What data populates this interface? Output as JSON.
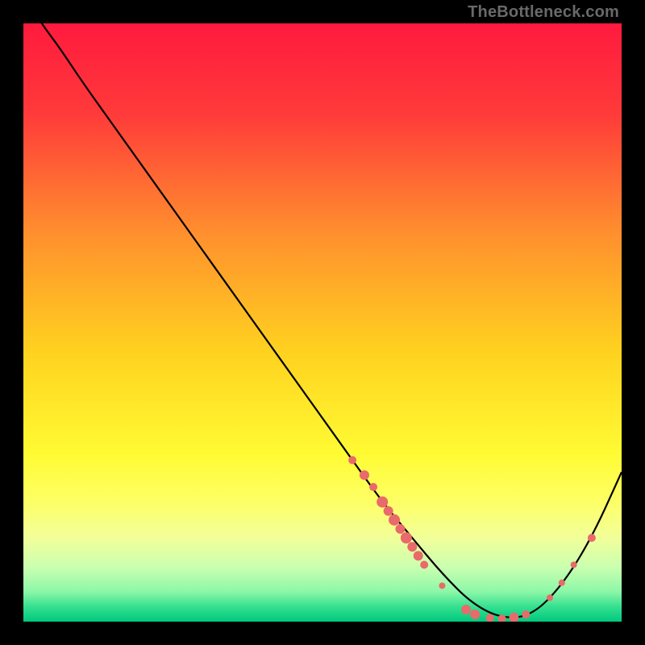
{
  "watermark": "TheBottleneck.com",
  "chart_data": {
    "type": "line",
    "title": "",
    "xlabel": "",
    "ylabel": "",
    "xlim": [
      0,
      100
    ],
    "ylim": [
      0,
      100
    ],
    "grid": false,
    "legend": false,
    "background_gradient": {
      "stops": [
        {
          "pos": 0.0,
          "color": "#ff1a3e"
        },
        {
          "pos": 0.15,
          "color": "#ff3a3a"
        },
        {
          "pos": 0.35,
          "color": "#ff8f2e"
        },
        {
          "pos": 0.55,
          "color": "#ffd21f"
        },
        {
          "pos": 0.72,
          "color": "#fffb33"
        },
        {
          "pos": 0.8,
          "color": "#fdff66"
        },
        {
          "pos": 0.86,
          "color": "#f2ff9a"
        },
        {
          "pos": 0.91,
          "color": "#c9ffb0"
        },
        {
          "pos": 0.95,
          "color": "#8cf7a8"
        },
        {
          "pos": 0.975,
          "color": "#35e08f"
        },
        {
          "pos": 1.0,
          "color": "#00c97e"
        }
      ]
    },
    "series": [
      {
        "name": "bottleneck-curve",
        "color": "#000000",
        "x": [
          0,
          3,
          6,
          10,
          15,
          20,
          25,
          30,
          35,
          40,
          45,
          50,
          55,
          60,
          65,
          70,
          75,
          80,
          85,
          90,
          95,
          100
        ],
        "y": [
          105,
          100,
          96,
          90,
          83,
          76,
          69,
          62,
          55,
          48,
          41,
          34,
          27,
          20,
          14,
          8,
          3,
          0.5,
          1,
          6,
          14,
          25
        ]
      }
    ],
    "markers": {
      "name": "highlighted-points",
      "color": "#e96a6a",
      "points": [
        {
          "x": 55,
          "y": 27,
          "r": 5
        },
        {
          "x": 57,
          "y": 24.5,
          "r": 6
        },
        {
          "x": 58.5,
          "y": 22.5,
          "r": 5
        },
        {
          "x": 60,
          "y": 20,
          "r": 7
        },
        {
          "x": 61,
          "y": 18.5,
          "r": 6
        },
        {
          "x": 62,
          "y": 17,
          "r": 7
        },
        {
          "x": 63,
          "y": 15.5,
          "r": 6
        },
        {
          "x": 64,
          "y": 14,
          "r": 7
        },
        {
          "x": 65,
          "y": 12.5,
          "r": 6
        },
        {
          "x": 66,
          "y": 11,
          "r": 6
        },
        {
          "x": 67,
          "y": 9.5,
          "r": 5
        },
        {
          "x": 70,
          "y": 6,
          "r": 4
        },
        {
          "x": 74,
          "y": 2,
          "r": 6
        },
        {
          "x": 75.5,
          "y": 1.2,
          "r": 6
        },
        {
          "x": 78,
          "y": 0.6,
          "r": 5
        },
        {
          "x": 80,
          "y": 0.5,
          "r": 5
        },
        {
          "x": 82,
          "y": 0.7,
          "r": 6
        },
        {
          "x": 84,
          "y": 1.2,
          "r": 5
        },
        {
          "x": 88,
          "y": 4,
          "r": 4
        },
        {
          "x": 90,
          "y": 6.5,
          "r": 4
        },
        {
          "x": 92,
          "y": 9.5,
          "r": 4
        },
        {
          "x": 95,
          "y": 14,
          "r": 5
        }
      ]
    }
  }
}
